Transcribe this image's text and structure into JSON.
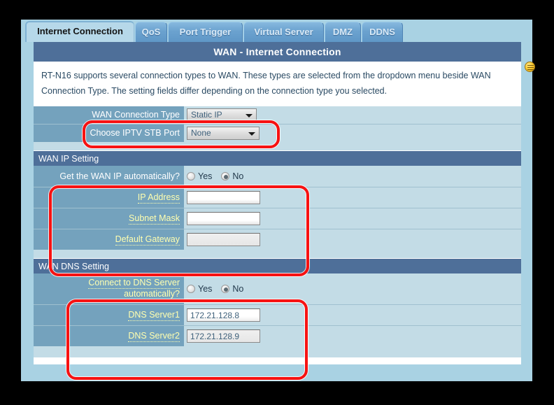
{
  "tabs": [
    {
      "label": "Internet Connection",
      "active": true
    },
    {
      "label": "QoS",
      "active": false
    },
    {
      "label": "Port Trigger",
      "active": false
    },
    {
      "label": "Virtual Server",
      "active": false
    },
    {
      "label": "DMZ",
      "active": false
    },
    {
      "label": "DDNS",
      "active": false
    }
  ],
  "panel": {
    "title": "WAN - Internet Connection",
    "intro_line1": "RT-N16 supports several connection types to WAN. These types are selected from the dropdown menu beside WAN",
    "intro_line2": "Connection Type. The setting fields differ depending on the connection type you selected."
  },
  "basic": {
    "wan_type_label": "WAN Connection Type",
    "wan_type_value": "Static IP",
    "iptv_label": "Choose IPTV STB Port",
    "iptv_value": "None"
  },
  "wan_ip": {
    "section_title": "WAN IP Setting",
    "auto_label": "Get the WAN IP automatically?",
    "yes_label": "Yes",
    "no_label": "No",
    "auto_selected": "No",
    "ip_address_label": "IP Address",
    "ip_address_value": "",
    "subnet_mask_label": "Subnet Mask",
    "subnet_mask_value": "",
    "default_gateway_label": "Default Gateway",
    "default_gateway_value": ""
  },
  "wan_dns": {
    "section_title": "WAN DNS Setting",
    "auto_label_line1": "Connect to DNS Server",
    "auto_label_line2": "automatically?",
    "yes_label": "Yes",
    "no_label": "No",
    "auto_selected": "No",
    "dns1_label": "DNS Server1",
    "dns1_value": "172.21.128.8",
    "dns2_label": "DNS Server2",
    "dns2_value": "172.21.128.9"
  },
  "icons": {
    "help": "help-face-icon"
  },
  "colors": {
    "accent_dark_blue": "#4e6f99",
    "page_blue": "#a9d2e3",
    "label_column": "#74a2bd",
    "value_column": "#c3dce6",
    "label_text": "#ffffb0",
    "annotation_red": "#f71212"
  }
}
